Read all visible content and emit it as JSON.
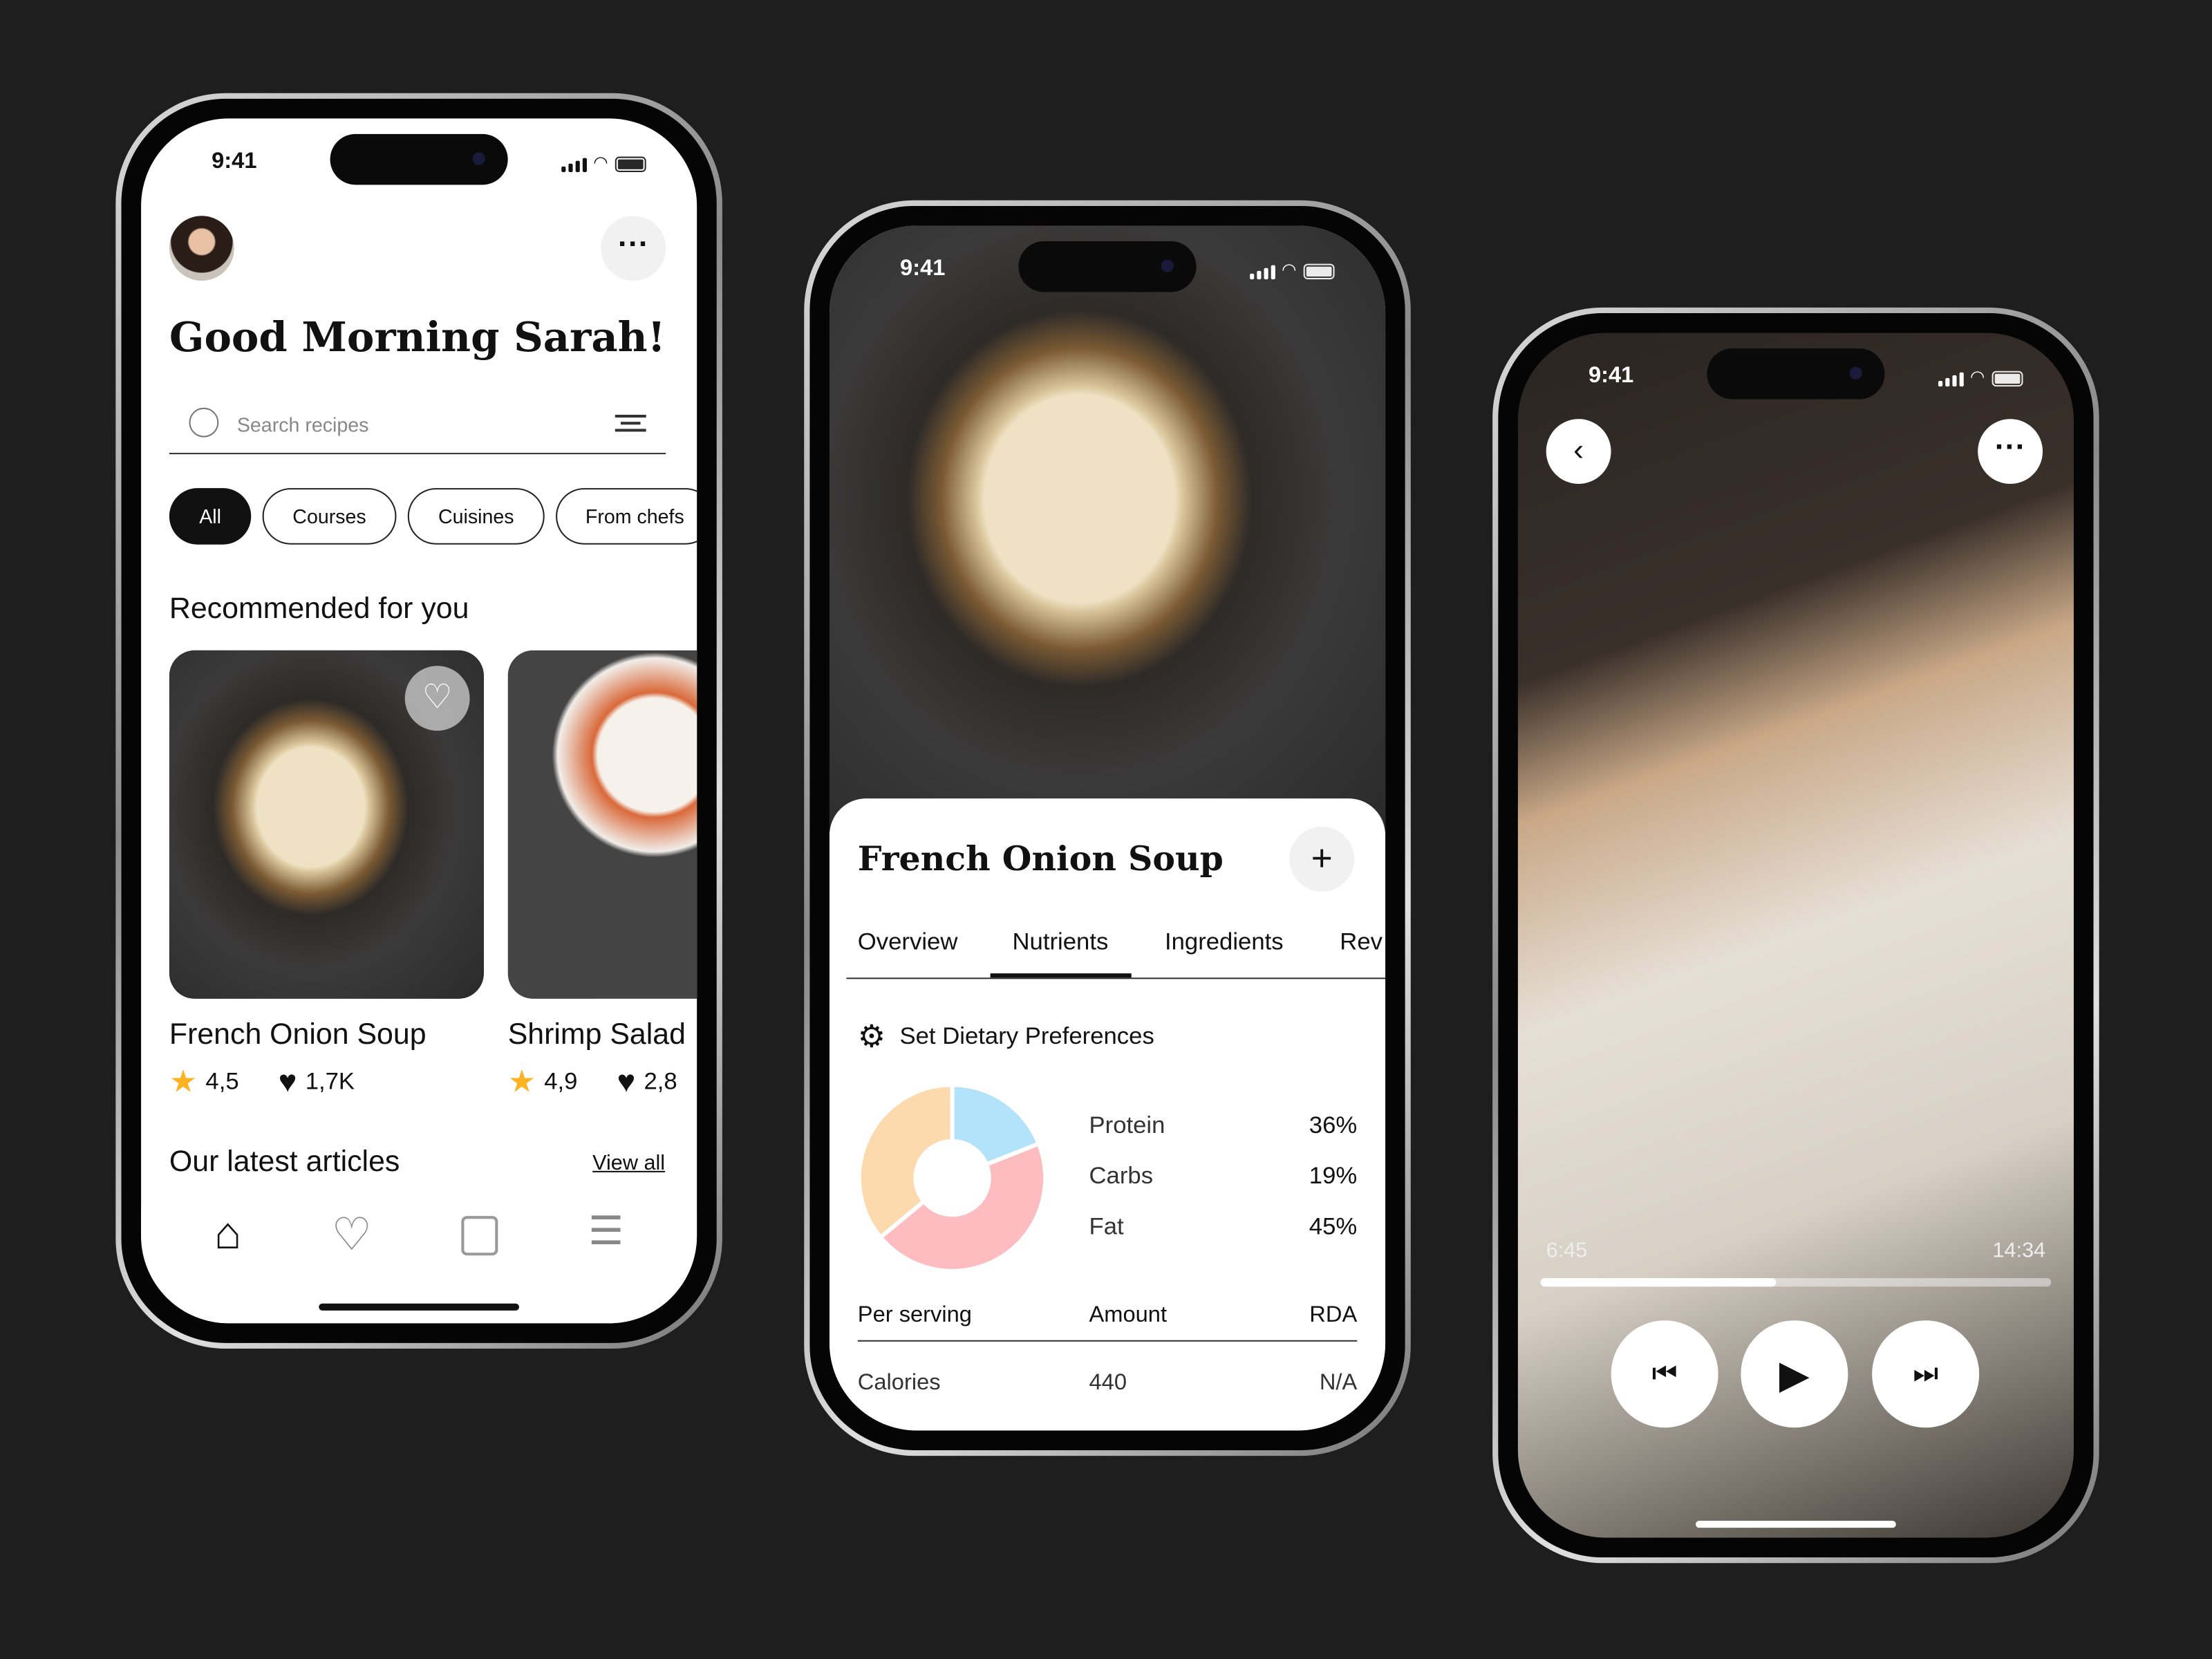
{
  "status": {
    "time": "9:41"
  },
  "home": {
    "greeting": "Good Morning Sarah!",
    "search_placeholder": "Search recipes",
    "chips": [
      "All",
      "Courses",
      "Cuisines",
      "From chefs"
    ],
    "recommended_title": "Recommended for you",
    "recipes": [
      {
        "name": "French Onion Soup",
        "rating": "4,5",
        "likes": "1,7K"
      },
      {
        "name": "Shrimp Salad",
        "rating": "4,9",
        "likes": "2,8"
      }
    ],
    "articles_title": "Our latest articles",
    "view_all": "View all",
    "nav": [
      "home-icon",
      "heart-icon",
      "calendar-icon",
      "list-icon"
    ]
  },
  "detail": {
    "title": "French Onion Soup",
    "tabs": [
      "Overview",
      "Nutrients",
      "Ingredients",
      "Rev"
    ],
    "active_tab": "Nutrients",
    "dietary_label": "Set Dietary Preferences",
    "chart_data": {
      "type": "pie",
      "series": [
        {
          "name": "Protein",
          "value": 36,
          "label": "36%",
          "color": "#fdd9ae"
        },
        {
          "name": "Carbs",
          "value": 19,
          "label": "19%",
          "color": "#b3e2fb"
        },
        {
          "name": "Fat",
          "value": 45,
          "label": "45%",
          "color": "#fdbcc0"
        }
      ]
    },
    "table": {
      "headers": [
        "Per serving",
        "Amount",
        "RDA"
      ],
      "rows": [
        [
          "Calories",
          "440",
          "N/A"
        ]
      ]
    }
  },
  "player": {
    "elapsed": "6:45",
    "total": "14:34",
    "progress": 0.46
  }
}
